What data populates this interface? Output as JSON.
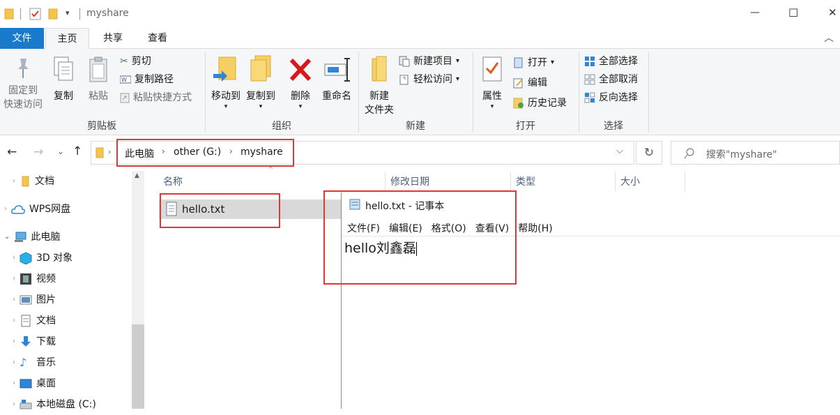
{
  "titlebar": {
    "path_label": "myshare",
    "minimize": "—",
    "maximize": "☐",
    "close": "✕"
  },
  "tabs": [
    {
      "label": "文件"
    },
    {
      "label": "主页"
    },
    {
      "label": "共享"
    },
    {
      "label": "查看"
    }
  ],
  "ribbon": {
    "clipboard": {
      "label": "剪贴板",
      "pin_line1": "固定到",
      "pin_line2": "快速访问",
      "copy": "复制",
      "paste": "粘贴",
      "cut": "剪切",
      "copy_path": "复制路径",
      "paste_shortcut": "粘贴快捷方式"
    },
    "organize": {
      "label": "组织",
      "move_to": "移动到",
      "copy_to": "复制到",
      "delete": "删除",
      "rename": "重命名"
    },
    "new": {
      "label": "新建",
      "new_folder_line1": "新建",
      "new_folder_line2": "文件夹",
      "new_item": "新建项目",
      "easy_access": "轻松访问"
    },
    "open": {
      "label": "打开",
      "properties": "属性",
      "open": "打开",
      "edit": "编辑",
      "history": "历史记录"
    },
    "select": {
      "label": "选择",
      "select_all": "全部选择",
      "select_none": "全部取消",
      "invert": "反向选择"
    }
  },
  "address": {
    "crumbs": [
      "此电脑",
      "other (G:)",
      "myshare"
    ],
    "search_placeholder": "搜索\"myshare\""
  },
  "nav_items": [
    "文档",
    "WPS网盘",
    "此电脑",
    "3D 对象",
    "视频",
    "图片",
    "文档",
    "下载",
    "音乐",
    "桌面",
    "本地磁盘 (C:)"
  ],
  "columns": {
    "name": "名称",
    "modified": "修改日期",
    "type": "类型",
    "size": "大小"
  },
  "files": [
    {
      "name": "hello.txt"
    }
  ],
  "notepad": {
    "title": "hello.txt - 记事本",
    "menu": [
      "文件(F)",
      "编辑(E)",
      "格式(O)",
      "查看(V)",
      "帮助(H)"
    ],
    "content": "hello刘鑫磊"
  }
}
